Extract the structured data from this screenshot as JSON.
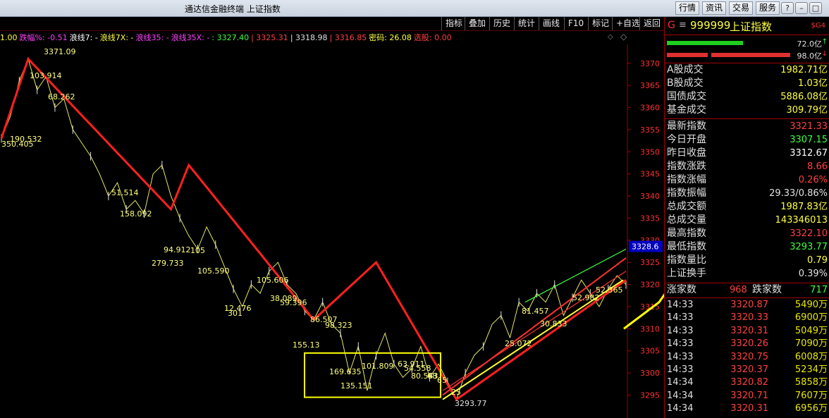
{
  "window": {
    "title": "通达信金融终端 上证指数",
    "menu": [
      "行情",
      "资讯",
      "交易",
      "服务"
    ],
    "controls": [
      "?",
      "–",
      "□",
      "×"
    ]
  },
  "toolbar": {
    "items": [
      "指标",
      "叠加",
      "历史",
      "统计",
      "画线",
      "F10",
      "标记",
      "+自选",
      "返回"
    ],
    "icons": [
      "diamond-small-icon",
      "diamond-icon"
    ]
  },
  "indicator": {
    "left_value": "1.00",
    "items": [
      {
        "text": "跌幅%: -0.51",
        "color": "#ff40ff"
      },
      {
        "text": "浪线7: -",
        "color": "#ffffff"
      },
      {
        "text": "浪线7X: -",
        "color": "#ffff40"
      },
      {
        "text": "浪线35: -",
        "color": "#ff40ff"
      },
      {
        "text": "浪线35X: -",
        "color": "#ff40ff"
      },
      {
        "text": ": 3327.40",
        "color": "#40ff40"
      },
      {
        "text": "| 3325.31",
        "color": "#ff4040"
      },
      {
        "text": "| 3318.98",
        "color": "#e0e0e0"
      },
      {
        "text": "| 3316.85",
        "color": "#ff4040"
      },
      {
        "text": "密码: 26.08",
        "color": "#ffff40"
      },
      {
        "text": "选股: 0.00",
        "color": "#ff4040"
      }
    ]
  },
  "chart_data": {
    "type": "line",
    "ylim": [
      3293,
      3373
    ],
    "yticks": [
      3295,
      3300,
      3305,
      3310,
      3315,
      3320,
      3325,
      3330,
      3335,
      3340,
      3345,
      3350,
      3355,
      3360,
      3365,
      3370
    ],
    "current_price": "3328.6",
    "price_path": [
      3353,
      3358,
      3366,
      3371,
      3364,
      3367,
      3360,
      3362,
      3355,
      3352,
      3349,
      3345,
      3340,
      3343,
      3337,
      3339,
      3336,
      3345,
      3347,
      3340,
      3335,
      3331,
      3328,
      3333,
      3329,
      3324,
      3319,
      3315,
      3320,
      3318,
      3323,
      3325,
      3320,
      3318,
      3314,
      3312,
      3316,
      3311,
      3309,
      3300,
      3306,
      3296,
      3304,
      3309,
      3302,
      3299,
      3301,
      3306,
      3299,
      3302,
      3298,
      3294,
      3300,
      3304,
      3306,
      3311,
      3313,
      3308,
      3316,
      3314,
      3318,
      3316,
      3320,
      3313,
      3317,
      3321,
      3318,
      3315,
      3319,
      3322,
      3320
    ],
    "red_path": [
      3353,
      3371,
      3337,
      3347,
      3312,
      3325,
      3294,
      3321
    ],
    "trend_lines": [
      {
        "color": "#40ff40",
        "from": 3316,
        "to": 3328
      },
      {
        "color": "#ff3030",
        "from": 3295,
        "to": 3326
      },
      {
        "color": "#ff3030",
        "from": 3296,
        "to": 3323
      }
    ],
    "yellow_overlay": [
      3310,
      3316,
      3328,
      3320,
      3350
    ],
    "labels": [
      "3371.09",
      "103.914",
      "68.262",
      "158.092",
      "51.514",
      "279.733",
      "94.912",
      "105",
      "105.590",
      "105.606",
      "12.476",
      "301",
      "38.089",
      "59.396",
      "155.13",
      "86.507",
      "98.323",
      "169.635",
      "135.151",
      "101.809",
      "63.911",
      "54.558",
      "80.543",
      "68",
      "65",
      "25",
      "3293.77",
      "81.457",
      "30.833",
      "25.072",
      "52.982",
      "52.365",
      "190.532",
      "350.405"
    ]
  },
  "rpanel": {
    "code": "999999",
    "name": "上证指数",
    "market": "G",
    "tag": "$G4",
    "bars": [
      {
        "pct": "72.0亿",
        "color": "#40ff40"
      },
      {
        "pct": "98.0亿",
        "color": "#ff3030"
      }
    ],
    "volume": [
      {
        "label": "A股成交",
        "value": "1982.71亿"
      },
      {
        "label": "B股成交",
        "value": "1.03亿"
      },
      {
        "label": "国债成交",
        "value": "5886.08亿"
      },
      {
        "label": "基金成交",
        "value": "309.79亿"
      }
    ],
    "stats": [
      {
        "label": "最新指数",
        "value": "3321.33",
        "color": "#ff4040"
      },
      {
        "label": "今日开盘",
        "value": "3307.15",
        "color": "#40ff40"
      },
      {
        "label": "昨日收盘",
        "value": "3312.67",
        "color": "#ffffff"
      },
      {
        "label": "指数涨跌",
        "value": "8.66",
        "color": "#ff4040"
      },
      {
        "label": "指数涨幅",
        "value": "0.26%",
        "color": "#ff4040"
      },
      {
        "label": "指数振幅",
        "value": "29.33/0.86%",
        "color": "#e0e0e0"
      },
      {
        "label": "总成交额",
        "value": "1987.83亿",
        "color": "#ffff40"
      },
      {
        "label": "总成交量",
        "value": "143346013",
        "color": "#ffff40"
      },
      {
        "label": "最高指数",
        "value": "3322.10",
        "color": "#ff4040"
      },
      {
        "label": "最低指数",
        "value": "3293.77",
        "color": "#40ff40"
      },
      {
        "label": "指数量比",
        "value": "0.79",
        "color": "#ffff40"
      },
      {
        "label": "上证换手",
        "value": "0.39%",
        "color": "#e0e0e0"
      }
    ],
    "updown": {
      "up_label": "涨家数",
      "up": "968",
      "down_label": "跌家数",
      "down": "717"
    },
    "ticks": [
      {
        "t": "14:33",
        "p": "3320.87",
        "v": "5490万"
      },
      {
        "t": "14:33",
        "p": "3320.33",
        "v": "6900万"
      },
      {
        "t": "14:33",
        "p": "3320.31",
        "v": "5049万"
      },
      {
        "t": "14:33",
        "p": "3320.26",
        "v": "7090万"
      },
      {
        "t": "14:33",
        "p": "3320.75",
        "v": "6008万"
      },
      {
        "t": "14:33",
        "p": "3320.37",
        "v": "5234万"
      },
      {
        "t": "14:34",
        "p": "3320.82",
        "v": "5858万"
      },
      {
        "t": "14:34",
        "p": "3320.71",
        "v": "7607万"
      },
      {
        "t": "14:34",
        "p": "3320.31",
        "v": "6956万"
      }
    ]
  }
}
